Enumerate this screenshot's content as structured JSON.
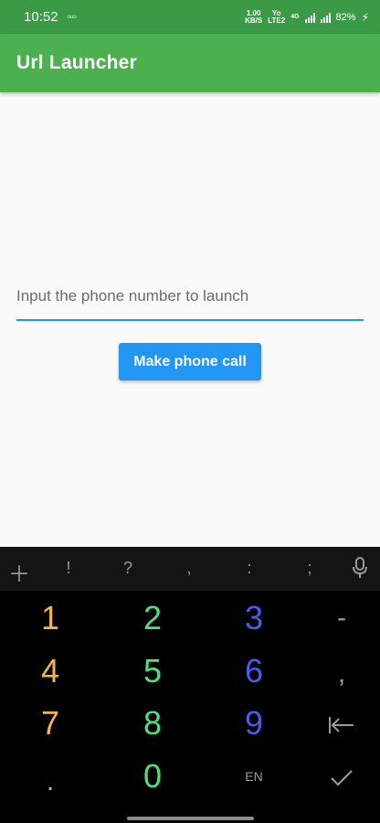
{
  "status_bar": {
    "time": "10:52",
    "tiny_label": "oüo",
    "speed_value": "1.00",
    "speed_unit": "KB/S",
    "volte_top": "Yo",
    "volte_bottom": "LTE2",
    "network_label": "4G",
    "battery": "82%"
  },
  "app_bar": {
    "title": "Url Launcher"
  },
  "main": {
    "phone_input_placeholder": "Input the phone number to launch",
    "call_button_label": "Make phone call"
  },
  "keyboard": {
    "symbols": [
      "!",
      "?",
      ",",
      ":",
      ";"
    ],
    "digits": [
      "1",
      "2",
      "3",
      "4",
      "5",
      "6",
      "7",
      "8",
      "9",
      "0"
    ],
    "dash": "-",
    "comma": ",",
    "dot": ".",
    "lang": "EN",
    "icons": {
      "add": "plus-icon",
      "mic": "microphone-icon",
      "tab": "tab-left-icon",
      "done": "check-icon"
    }
  },
  "colors": {
    "status_bar": "#3a9a46",
    "app_bar": "#4caf50",
    "accent": "#2196f3",
    "key_orange": "#f3b649",
    "key_green": "#4fe07e",
    "key_blue": "#4a5cf0"
  }
}
